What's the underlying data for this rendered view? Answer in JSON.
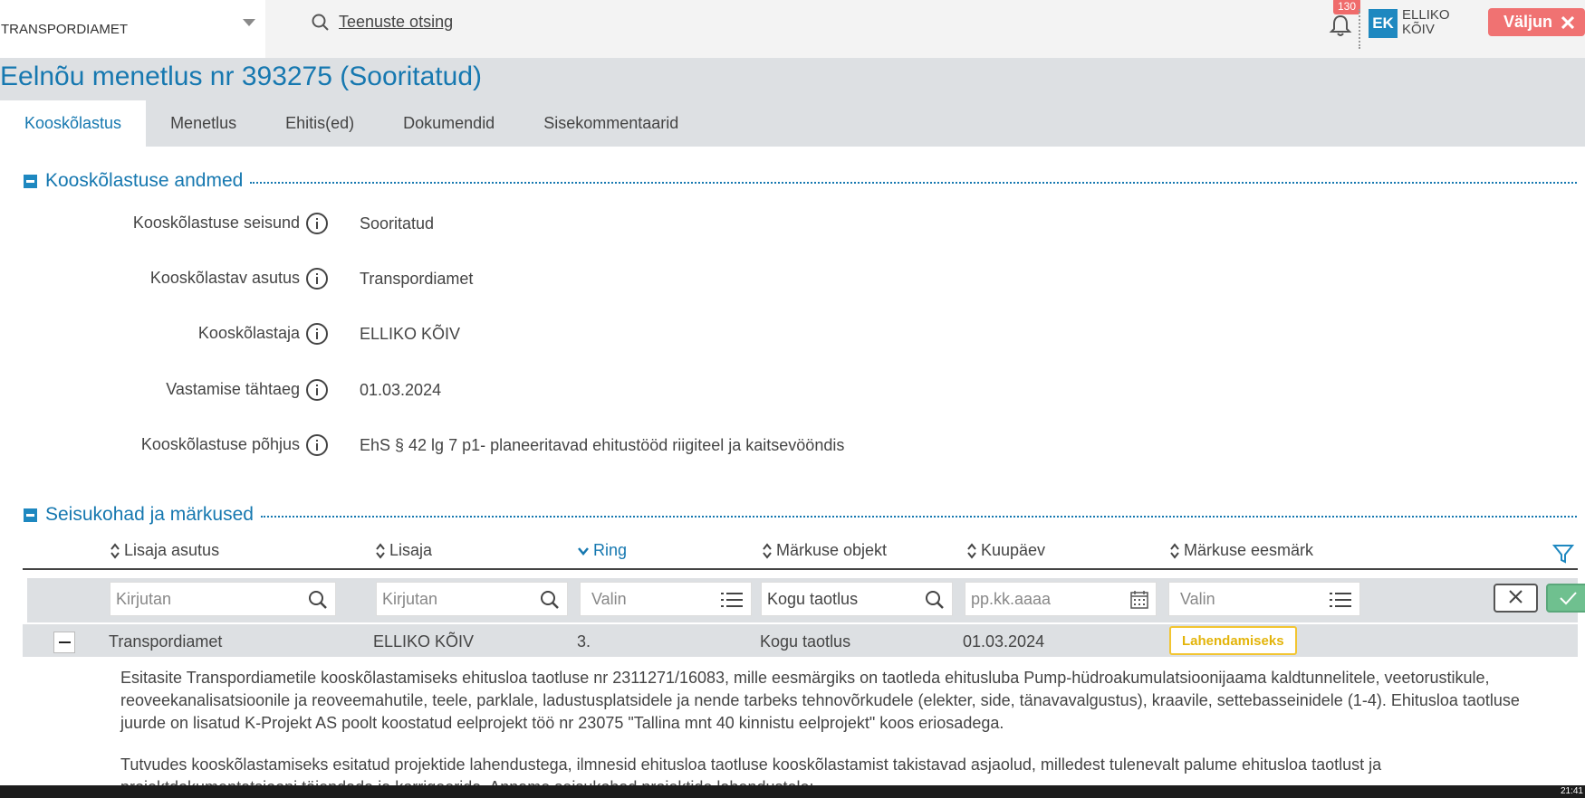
{
  "header": {
    "org_name": "TRANSPORDIAMET",
    "service_search": "Teenuste otsing",
    "notification_count": "130",
    "user_initials": "EK",
    "user_name": "ELLIKO KÕIV",
    "logout_label": "Väljun"
  },
  "page": {
    "title": "Eelnõu menetlus nr 393275 (Sooritatud)",
    "tabs": [
      {
        "label": "Kooskõlastus",
        "active": true
      },
      {
        "label": "Menetlus",
        "active": false
      },
      {
        "label": "Ehitis(ed)",
        "active": false
      },
      {
        "label": "Dokumendid",
        "active": false
      },
      {
        "label": "Sisekommentaarid",
        "active": false
      }
    ]
  },
  "coordination_section": {
    "title": "Kooskõlastuse andmed",
    "fields": [
      {
        "label": "Kooskõlastuse seisund",
        "value": "Sooritatud"
      },
      {
        "label": "Kooskõlastav asutus",
        "value": "Transpordiamet"
      },
      {
        "label": "Kooskõlastaja",
        "value": "ELLIKO KÕIV"
      },
      {
        "label": "Vastamise tähtaeg",
        "value": "01.03.2024"
      },
      {
        "label": "Kooskõlastuse põhjus",
        "value": "EhS § 42 lg 7 p1- planeeritavad ehitustööd riigiteel ja kaitsevööndis"
      }
    ]
  },
  "remarks_section": {
    "title": "Seisukohad ja märkused",
    "columns": [
      {
        "label": "Lisaja asutus",
        "sort": "none"
      },
      {
        "label": "Lisaja",
        "sort": "none"
      },
      {
        "label": "Ring",
        "sort": "desc"
      },
      {
        "label": "Märkuse objekt",
        "sort": "none"
      },
      {
        "label": "Kuupäev",
        "sort": "none"
      },
      {
        "label": "Märkuse eesmärk",
        "sort": "none"
      }
    ],
    "filters": {
      "institution_placeholder": "Kirjutan",
      "author_placeholder": "Kirjutan",
      "round_placeholder": "Valin",
      "object_value": "Kogu taotlus",
      "date_placeholder": "pp.kk.aaaa",
      "purpose_placeholder": "Valin"
    },
    "row": {
      "institution": "Transpordiamet",
      "author": "ELLIKO KÕIV",
      "round": "3.",
      "object": "Kogu taotlus",
      "date": "01.03.2024",
      "purpose": "Lahendamiseks"
    },
    "description_p1": "Esitasite Transpordiametile kooskõlastamiseks ehitusloa taotluse nr 2311271/16083, mille eesmärgiks on taotleda ehitusluba Pump-hüdroakumulatsioonijaama kaldtunnelitele, veetorustikule, reoveekanalisatsioonile ja reoveemahutile, teele, parklale, ladustusplatsidele ja nende tarbeks tehnovõrkudele (elekter, side, tänavavalgustus), kraavile, settebasseinidele (1-4). Ehitusloa taotluse juurde on lisatud K-Projekt AS poolt koostatud eelprojekt töö nr 23075 \"Tallina mnt 40 kinnistu eelprojekt\" koos eriosadega.",
    "description_p2": "Tutvudes kooskõlastamiseks esitatud projektide lahendustega, ilmnesid ehitusloa taotluse kooskõlastamist takistavad asjaolud, milledest tulenevalt palume ehitusloa taotlust ja projektdokumentatsiooni täiendada ja korrigeerida. Anname seisukohad projektide lahendustele:"
  },
  "taskbar": {
    "clock": "21:41"
  }
}
